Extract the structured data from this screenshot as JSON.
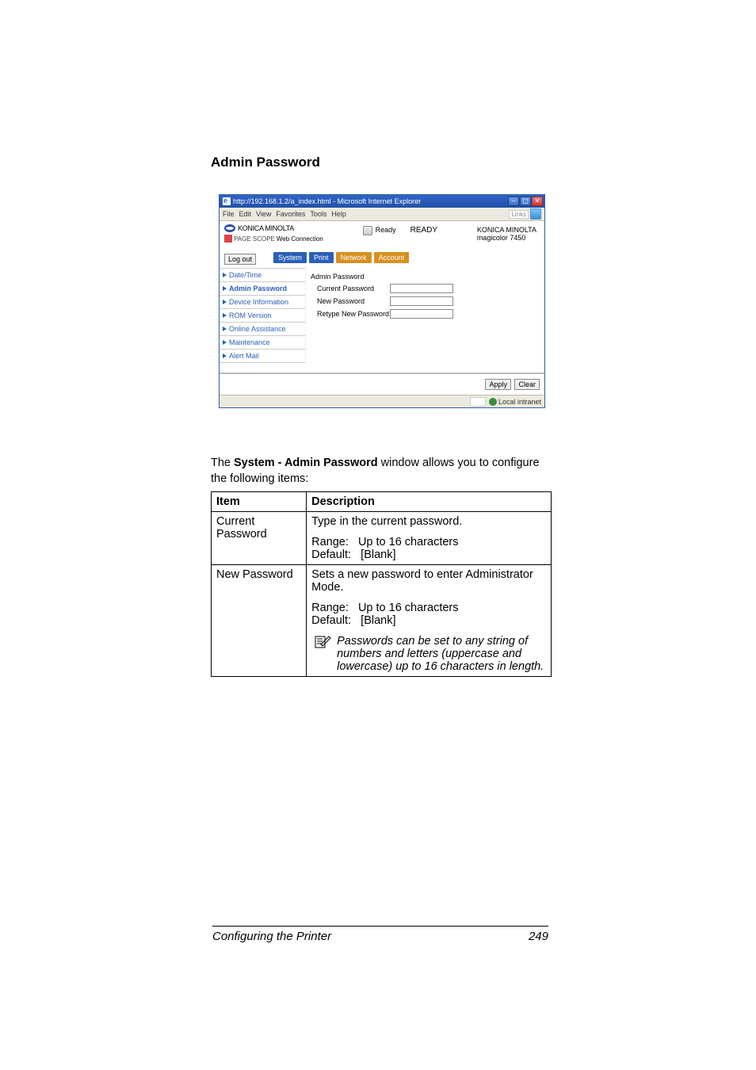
{
  "page": {
    "heading": "Admin Password",
    "intro_prefix": "The ",
    "intro_bold": "System - Admin Password",
    "intro_suffix": " window allows you to configure the following items:",
    "footer_section": "Configuring the Printer",
    "footer_page": "249"
  },
  "ie": {
    "title": "http://192.168.1.2/a_index.html - Microsoft Internet Explorer",
    "menus": {
      "file": "File",
      "edit": "Edit",
      "view": "View",
      "favorites": "Favorites",
      "tools": "Tools",
      "help": "Help"
    },
    "links_label": "Links",
    "status_zone": "Local intranet"
  },
  "printer": {
    "brand": "KONICA MINOLTA",
    "pagescope_prefix": "PAGE SCOPE",
    "pagescope_text": "Web Connection",
    "ready_small": "Ready",
    "ready_big": "READY",
    "info_brand": "KONICA MINOLTA",
    "info_model": "magicolor 7450",
    "logout": "Log out",
    "tabs": {
      "system": "System",
      "print": "Print",
      "network": "Network",
      "account": "Account"
    },
    "side": {
      "date_time": "Date/Time",
      "admin_password": "Admin Password",
      "device_info": "Device Information",
      "rom_version": "ROM Version",
      "online_assist": "Online Assistance",
      "maintenance": "Maintenance",
      "alert_mail": "Alert Mail"
    },
    "form": {
      "heading": "Admin Password",
      "current": "Current Password",
      "new": "New Password",
      "retype": "Retype New Password"
    },
    "buttons": {
      "apply": "Apply",
      "clear": "Clear"
    }
  },
  "table": {
    "head_item": "Item",
    "head_desc": "Description",
    "rows": [
      {
        "item": "Current Password",
        "desc_line1": "Type in the current password.",
        "desc_range": "Range:   Up to 16 characters",
        "desc_default": "Default:   [Blank]"
      },
      {
        "item": "New Password",
        "desc_line1": "Sets a new password to enter Administrator Mode.",
        "desc_range": "Range:   Up to 16 characters",
        "desc_default": "Default:   [Blank]",
        "note": "Passwords can be set to any string of numbers and letters (uppercase and lowercase) up to 16 characters in length."
      }
    ]
  }
}
